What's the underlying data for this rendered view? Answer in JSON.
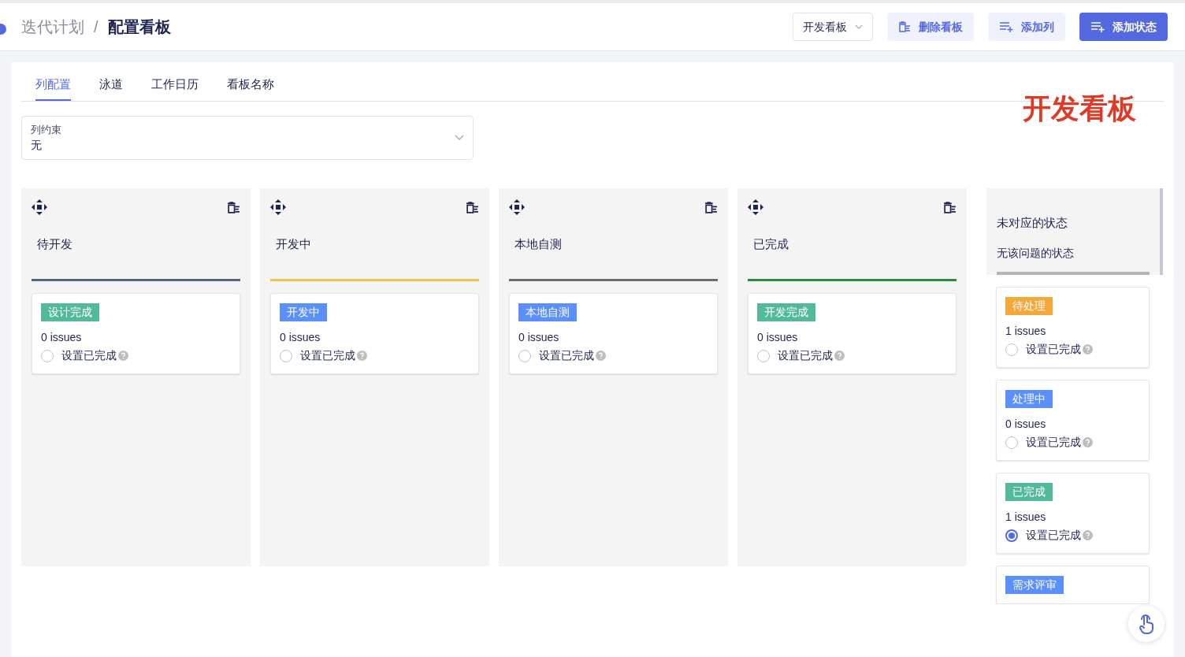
{
  "breadcrumb": {
    "parent": "迭代计划",
    "separator": "/",
    "current": "配置看板"
  },
  "header": {
    "board_select": "开发看板",
    "buttons": [
      {
        "kind": "delete",
        "label": "删除看板"
      },
      {
        "kind": "add_column",
        "label": "添加列"
      },
      {
        "kind": "add_status",
        "label": "添加状态"
      }
    ]
  },
  "tabs": [
    {
      "label": "列配置",
      "selected": true
    },
    {
      "label": "泳道",
      "selected": false
    },
    {
      "label": "工作日历",
      "selected": false
    },
    {
      "label": "看板名称",
      "selected": false
    }
  ],
  "board_title": "开发看板",
  "column_constraint": {
    "label": "列约束",
    "value": "无"
  },
  "columns": [
    {
      "name": "待开发",
      "color": "#4f6587",
      "statuses": [
        {
          "tag": "设计完成",
          "color": "#52b99a",
          "issues": "0 issues",
          "done_label": "设置已完成",
          "done": false
        }
      ]
    },
    {
      "name": "开发中",
      "color": "#f2c14e",
      "statuses": [
        {
          "tag": "开发中",
          "color": "#5b8ff9",
          "issues": "0 issues",
          "done_label": "设置已完成",
          "done": false
        }
      ]
    },
    {
      "name": "本地自测",
      "color": "#6b6b6b",
      "statuses": [
        {
          "tag": "本地自测",
          "color": "#5b8ff9",
          "issues": "0 issues",
          "done_label": "设置已完成",
          "done": false
        }
      ]
    },
    {
      "name": "已完成",
      "color": "#2e8b3a",
      "statuses": [
        {
          "tag": "开发完成",
          "color": "#52b99a",
          "issues": "0 issues",
          "done_label": "设置已完成",
          "done": false
        }
      ]
    }
  ],
  "unmapped": {
    "title": "未对应的状态",
    "subtitle": "无该问题的状态",
    "statuses": [
      {
        "tag": "待处理",
        "color": "#f5a83a",
        "issues": "1 issues",
        "done_label": "设置已完成",
        "done": false
      },
      {
        "tag": "处理中",
        "color": "#5b8ff9",
        "issues": "0 issues",
        "done_label": "设置已完成",
        "done": false
      },
      {
        "tag": "已完成",
        "color": "#52b99a",
        "issues": "1 issues",
        "done_label": "设置已完成",
        "done": true
      },
      {
        "tag": "需求评审",
        "color": "#5b8ff9"
      }
    ]
  }
}
